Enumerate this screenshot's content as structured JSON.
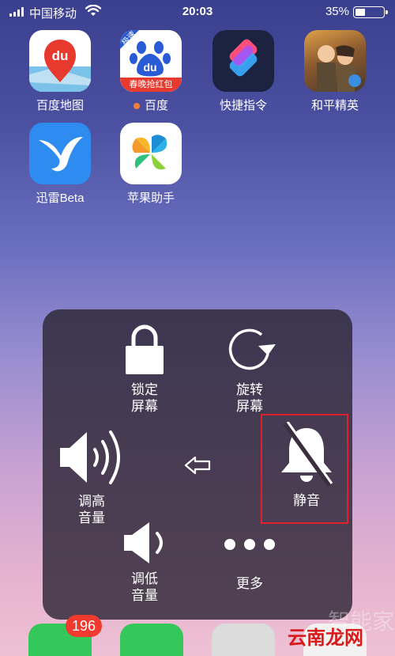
{
  "status_bar": {
    "carrier": "中国移动",
    "time": "20:03",
    "battery_percent": "35%",
    "battery_level": 0.35
  },
  "apps": [
    {
      "label": "百度地图",
      "icon": "baidu-map-icon"
    },
    {
      "label": "百度",
      "icon": "baidu-icon",
      "has_dot": true,
      "badge_top": "极速",
      "badge_bottom": "春晚抢红包"
    },
    {
      "label": "快捷指令",
      "icon": "shortcuts-icon"
    },
    {
      "label": "和平精英",
      "icon": "game-icon"
    },
    {
      "label": "迅雷Beta",
      "icon": "xunlei-icon"
    },
    {
      "label": "苹果助手",
      "icon": "apple-helper-icon"
    }
  ],
  "assistive_menu": {
    "lock": "锁定\n屏幕",
    "rotate": "旋转\n屏幕",
    "volume_up": "调高\n音量",
    "mute": "静音",
    "volume_down": "调低\n音量",
    "more": "更多"
  },
  "dock": {
    "messages_badge": "196"
  },
  "watermark": {
    "text": "云南龙网",
    "faint": "智能家"
  },
  "colors": {
    "highlight_border": "#e0202a",
    "badge": "#f03a30"
  }
}
